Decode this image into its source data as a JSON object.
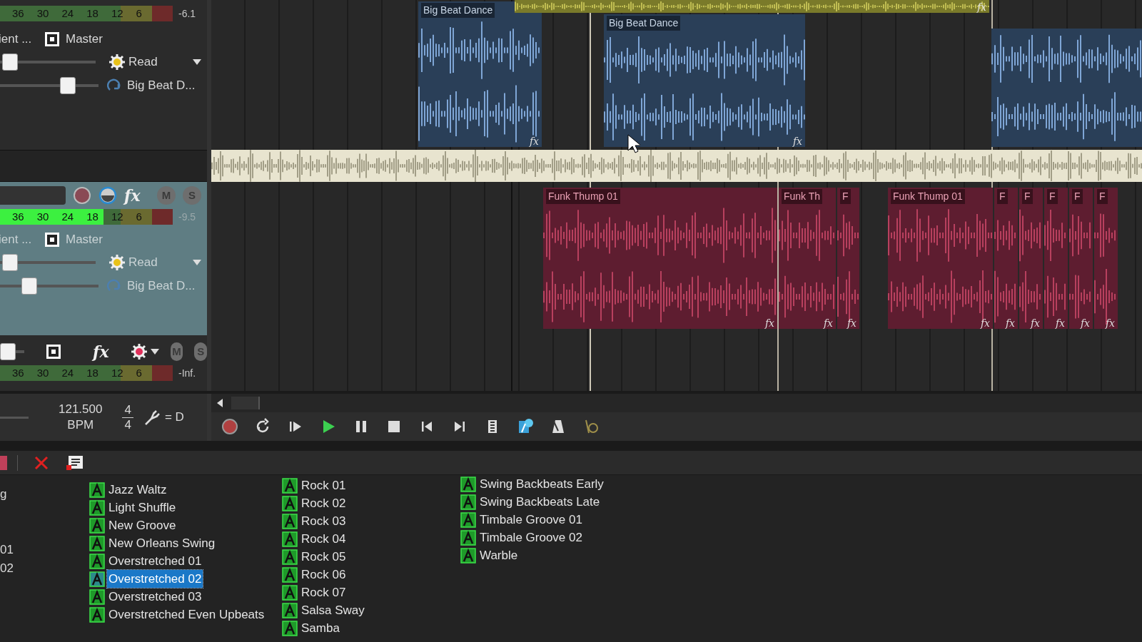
{
  "tracks": [
    {
      "selected": false,
      "meter_scale": [
        "36",
        "30",
        "24",
        "18",
        "12",
        "6"
      ],
      "meter_reading": "-6.1",
      "send_label": "ient ...",
      "bus": "Master",
      "pan": {
        "level": 0.03
      },
      "automation": "Read",
      "volume": {
        "level": 0.72
      },
      "clip_name": "Big Beat D..."
    },
    {
      "selected": true,
      "fx": "fx",
      "mute": "M",
      "solo": "S",
      "meter_scale": [
        "36",
        "30",
        "24",
        "18",
        "12",
        "6"
      ],
      "meter": {
        "level": 0.6
      },
      "meter_reading": "-9.5",
      "send_label": "ient ...",
      "bus": "Master",
      "pan": {
        "level": 0.03
      },
      "automation": "Read",
      "volume": {
        "level": 0.26
      },
      "clip_name": "Big Beat D..."
    },
    {
      "selected": false,
      "fader": {
        "level": 0
      },
      "fx": "fx",
      "mute": "M",
      "solo": "S",
      "meter_scale": [
        "36",
        "30",
        "24",
        "18",
        "12",
        "6"
      ],
      "meter_reading": "-Inf."
    }
  ],
  "lanes": [
    {
      "kind": "audio",
      "clips": [
        {
          "label": "Big Beat Dance",
          "color": "#2a3f58",
          "badge": "fx"
        },
        {
          "color": "#7a7a2a",
          "badge": "fx"
        },
        {
          "label": "Big Beat Dance",
          "color": "#2a3f58",
          "badge": "fx"
        },
        {
          "color": "#2a3f58"
        }
      ]
    },
    {
      "kind": "strip"
    },
    {
      "kind": "audio",
      "clips": [
        {
          "label": "Funk Thump 01",
          "color": "#5e1d30",
          "badge": "fx"
        },
        {
          "label": "Funk Th",
          "color": "#5e1d30",
          "badge": "fx"
        },
        {
          "label": "F",
          "color": "#5e1d30",
          "badge": "fx"
        },
        {
          "label": "Funk Thump 01",
          "color": "#5e1d30",
          "badge": "fx"
        },
        {
          "label": "F",
          "color": "#5e1d30",
          "badge": "fx"
        },
        {
          "label": "F",
          "color": "#5e1d30",
          "badge": "fx"
        },
        {
          "label": "F",
          "color": "#5e1d30",
          "badge": "fx"
        },
        {
          "label": "F",
          "color": "#5e1d30",
          "badge": "fx"
        },
        {
          "label": "F",
          "color": "#5e1d30",
          "badge": "fx"
        }
      ]
    },
    {
      "kind": "empty"
    }
  ],
  "tempo": {
    "bpm": "121.500",
    "unit": "BPM",
    "beats": "4",
    "note": "4",
    "key": "= D"
  },
  "transport": [
    {
      "kind": "record"
    },
    {
      "kind": "loop"
    },
    {
      "kind": "play-start"
    },
    {
      "kind": "play"
    },
    {
      "kind": "pause"
    },
    {
      "kind": "stop"
    },
    {
      "kind": "prev"
    },
    {
      "kind": "next"
    },
    {
      "kind": "film"
    },
    {
      "kind": "metronome-clock"
    },
    {
      "kind": "metronome"
    },
    {
      "kind": "count"
    }
  ],
  "browser": {
    "cut_column": [
      "g",
      "01",
      "02"
    ],
    "columns": [
      [
        {
          "name": "Jazz Waltz",
          "selected": false
        },
        {
          "name": "Light Shuffle",
          "selected": false
        },
        {
          "name": "New Groove",
          "selected": false
        },
        {
          "name": "New Orleans Swing",
          "selected": false
        },
        {
          "name": "Overstretched 01",
          "selected": false
        },
        {
          "name": "Overstretched 02",
          "selected": true
        },
        {
          "name": "Overstretched 03",
          "selected": false
        },
        {
          "name": "Overstretched Even Upbeats",
          "selected": false
        }
      ],
      [
        {
          "name": "Rock 01",
          "selected": false
        },
        {
          "name": "Rock 02",
          "selected": false
        },
        {
          "name": "Rock 03",
          "selected": false
        },
        {
          "name": "Rock 04",
          "selected": false
        },
        {
          "name": "Rock 05",
          "selected": false
        },
        {
          "name": "Rock 06",
          "selected": false
        },
        {
          "name": "Rock 07",
          "selected": false
        },
        {
          "name": "Salsa Sway",
          "selected": false
        },
        {
          "name": "Samba",
          "selected": false
        }
      ],
      [
        {
          "name": "Swing Backbeats Early",
          "selected": false
        },
        {
          "name": "Swing Backbeats Late",
          "selected": false
        },
        {
          "name": "Timbale Groove 01",
          "selected": false
        },
        {
          "name": "Timbale Groove 02",
          "selected": false
        },
        {
          "name": "Warble",
          "selected": false
        }
      ]
    ]
  }
}
